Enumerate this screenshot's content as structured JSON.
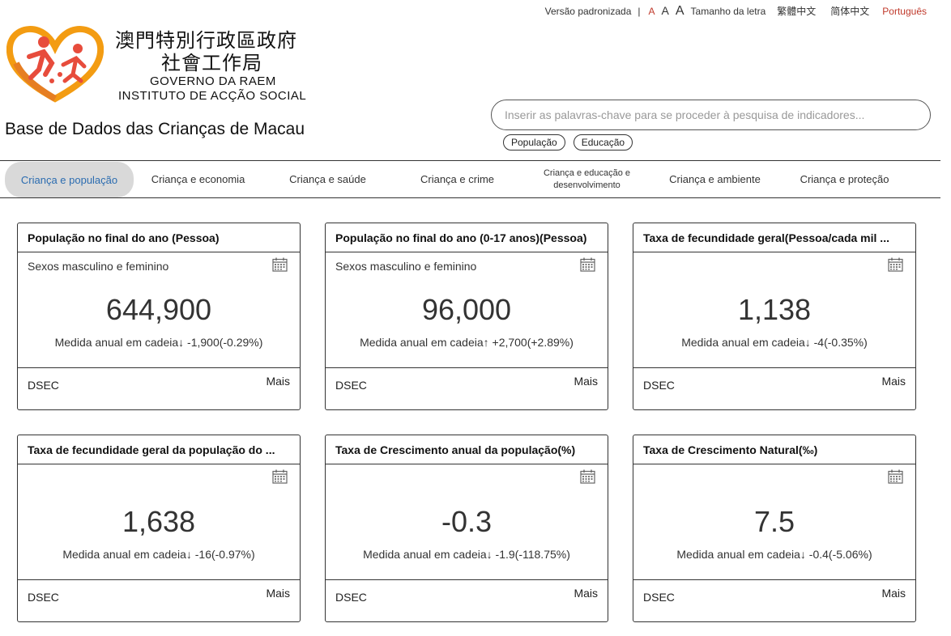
{
  "topbar": {
    "standard_version": "Versão padronizada",
    "separator": "|",
    "font_small": "A",
    "font_medium": "A",
    "font_large": "A",
    "font_size_label": "Tamanho da letra",
    "lang_traditional": "繁體中文",
    "lang_simplified": "简体中文",
    "lang_portuguese": "Português"
  },
  "logo": {
    "zh_line1": "澳門特別行政區政府",
    "zh_line2": "社會工作局",
    "pt_line1": "GOVERNO DA RAEM",
    "pt_line2": "INSTITUTO DE ACÇÃO SOCIAL"
  },
  "site_title": "Base de Dados das Crianças de Macau",
  "search": {
    "placeholder": "Inserir as palavras-chave para se proceder à pesquisa de indicadores...",
    "tags": [
      "População",
      "Educação"
    ]
  },
  "nav": {
    "items": [
      "Criança e população",
      "Criança e economia",
      "Criança e saúde",
      "Criança e crime",
      "Criança e educação e desenvolvimento",
      "Criança e ambiente",
      "Criança e proteção"
    ],
    "active_index": 0
  },
  "colors": {
    "accent_red": "#c0392b",
    "active_nav_text": "#2b6cb0",
    "active_nav_bg": "#d9d9d9",
    "logo_orange": "#f39c12",
    "logo_red": "#e74c3c"
  },
  "cards": [
    {
      "title": "População no final do ano (Pessoa)",
      "subtitle": "Sexos masculino e feminino",
      "value": "644,900",
      "change": "Medida anual em cadeia↓ -1,900(-0.29%)",
      "source": "DSEC",
      "more": "Mais"
    },
    {
      "title": "População no final do ano (0-17 anos)(Pessoa)",
      "subtitle": "Sexos masculino e feminino",
      "value": "96,000",
      "change": "Medida anual em cadeia↑ +2,700(+2.89%)",
      "source": "DSEC",
      "more": "Mais"
    },
    {
      "title": "Taxa de fecundidade geral(Pessoa/cada mil ...",
      "subtitle": "",
      "value": "1,138",
      "change": "Medida anual em cadeia↓ -4(-0.35%)",
      "source": "DSEC",
      "more": "Mais"
    },
    {
      "title": "Taxa de fecundidade geral da população do ...",
      "subtitle": "",
      "value": "1,638",
      "change": "Medida anual em cadeia↓ -16(-0.97%)",
      "source": "DSEC",
      "more": "Mais"
    },
    {
      "title": "Taxa de Crescimento anual da população(%)",
      "subtitle": "",
      "value": "-0.3",
      "change": "Medida anual em cadeia↓ -1.9(-118.75%)",
      "source": "DSEC",
      "more": "Mais"
    },
    {
      "title": "Taxa de Crescimento Natural(‰)",
      "subtitle": "",
      "value": "7.5",
      "change": "Medida anual em cadeia↓ -0.4(-5.06%)",
      "source": "DSEC",
      "more": "Mais"
    }
  ]
}
